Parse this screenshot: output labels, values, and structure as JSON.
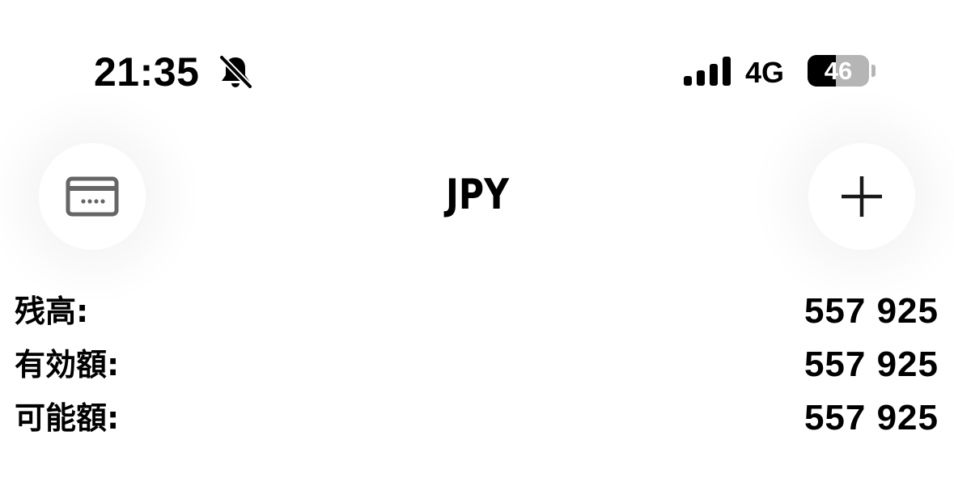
{
  "status_bar": {
    "time": "21:35",
    "network": "4G",
    "battery_level": "46",
    "battery_fraction": 0.46,
    "icons": {
      "bell": "bell-slash-icon",
      "signal": "cellular-signal-icon",
      "battery": "battery-icon"
    }
  },
  "header": {
    "currency": "JPY",
    "left_button_icon": "card-icon",
    "right_button_icon": "plus-icon"
  },
  "balances": [
    {
      "label": "残高:",
      "value": "557 925"
    },
    {
      "label": "有効額:",
      "value": "557 925"
    },
    {
      "label": "可能額:",
      "value": "557 925"
    }
  ],
  "colors": {
    "icon_gray": "#666666",
    "battery_empty": "#b5b5b5",
    "text": "#000000"
  }
}
